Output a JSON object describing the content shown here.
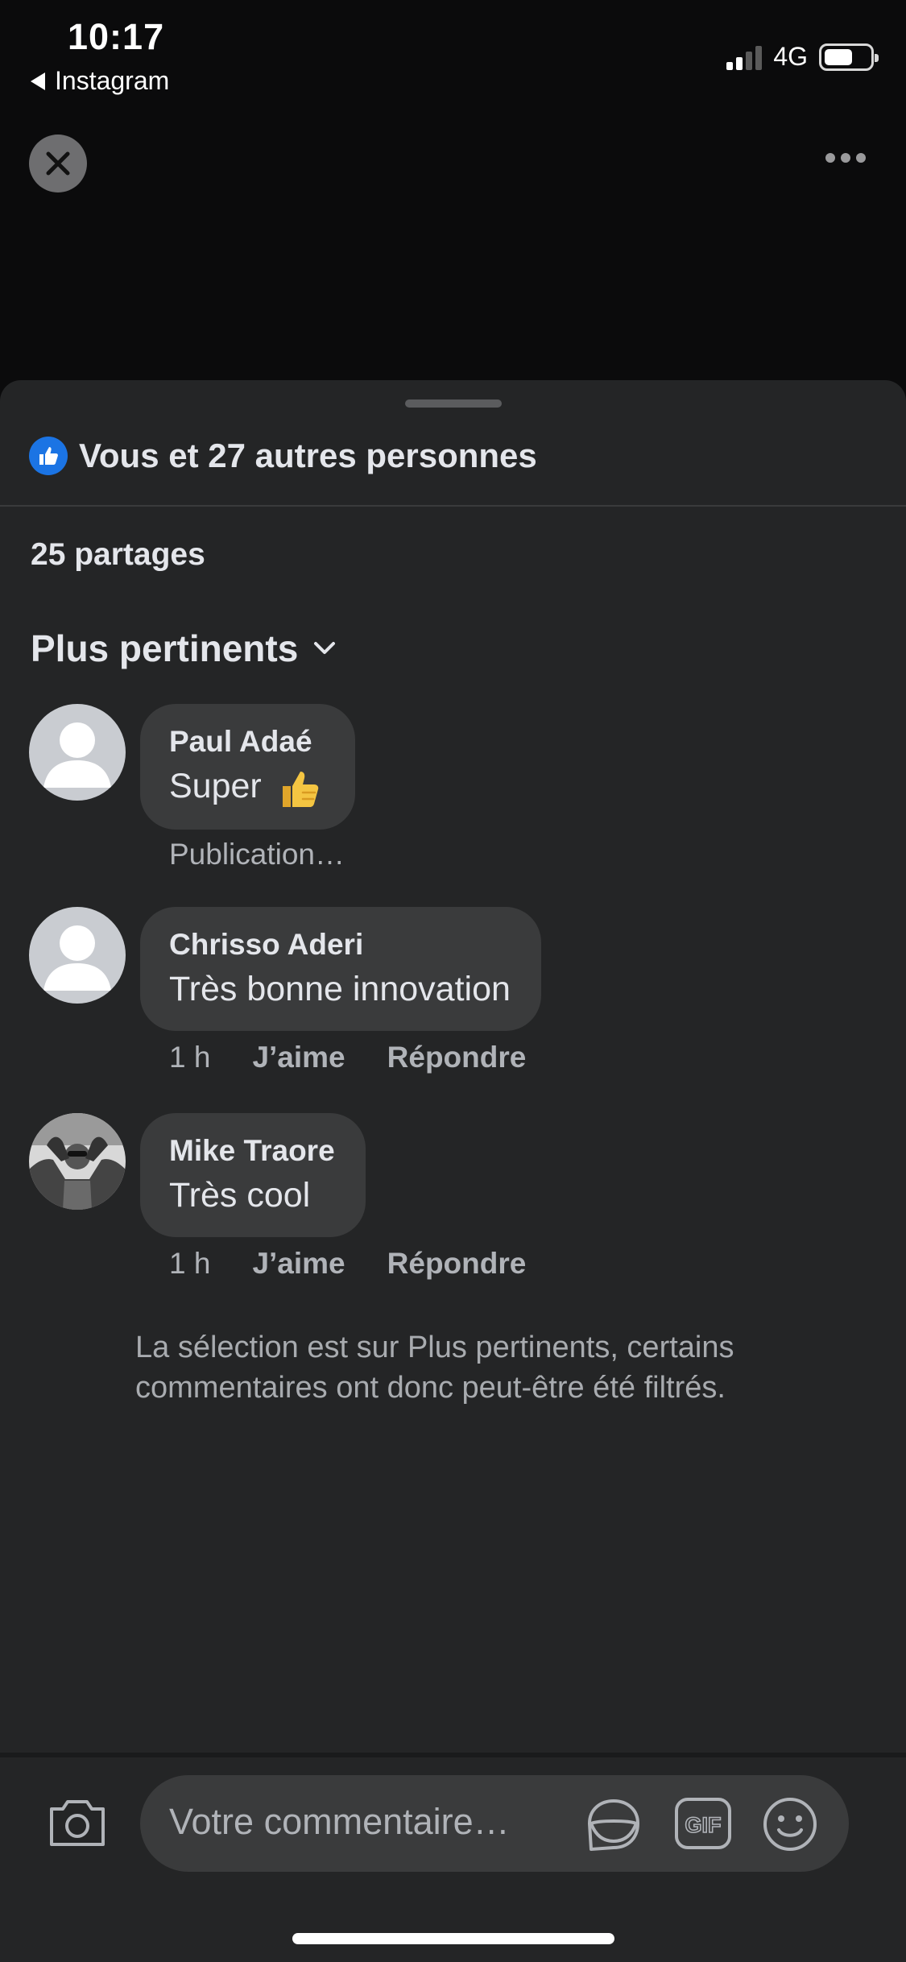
{
  "status": {
    "time": "10:17",
    "back_app": "Instagram",
    "network": "4G"
  },
  "sheet": {
    "reactions_text": "Vous et 27 autres personnes",
    "shares_text": "25 partages",
    "sort_label": "Plus pertinents",
    "comments": [
      {
        "author": "Paul Adaé",
        "text": "Super",
        "meta": [
          "Publication…"
        ]
      },
      {
        "author": "Chrisso Aderi",
        "text": "Très bonne innovation",
        "meta": [
          "1 h",
          "J’aime",
          "Répondre"
        ]
      },
      {
        "author": "Mike Traore",
        "text": "Très cool",
        "meta": [
          "1 h",
          "J’aime",
          "Répondre"
        ]
      }
    ],
    "filter_note": "La sélection est sur Plus pertinents, certains commentaires ont donc peut-être été filtrés."
  },
  "composer": {
    "placeholder": "Votre commentaire…"
  },
  "colors": {
    "accent": "#1b74e4",
    "sheet_bg": "#242526",
    "bubble_bg": "#3a3b3c"
  }
}
